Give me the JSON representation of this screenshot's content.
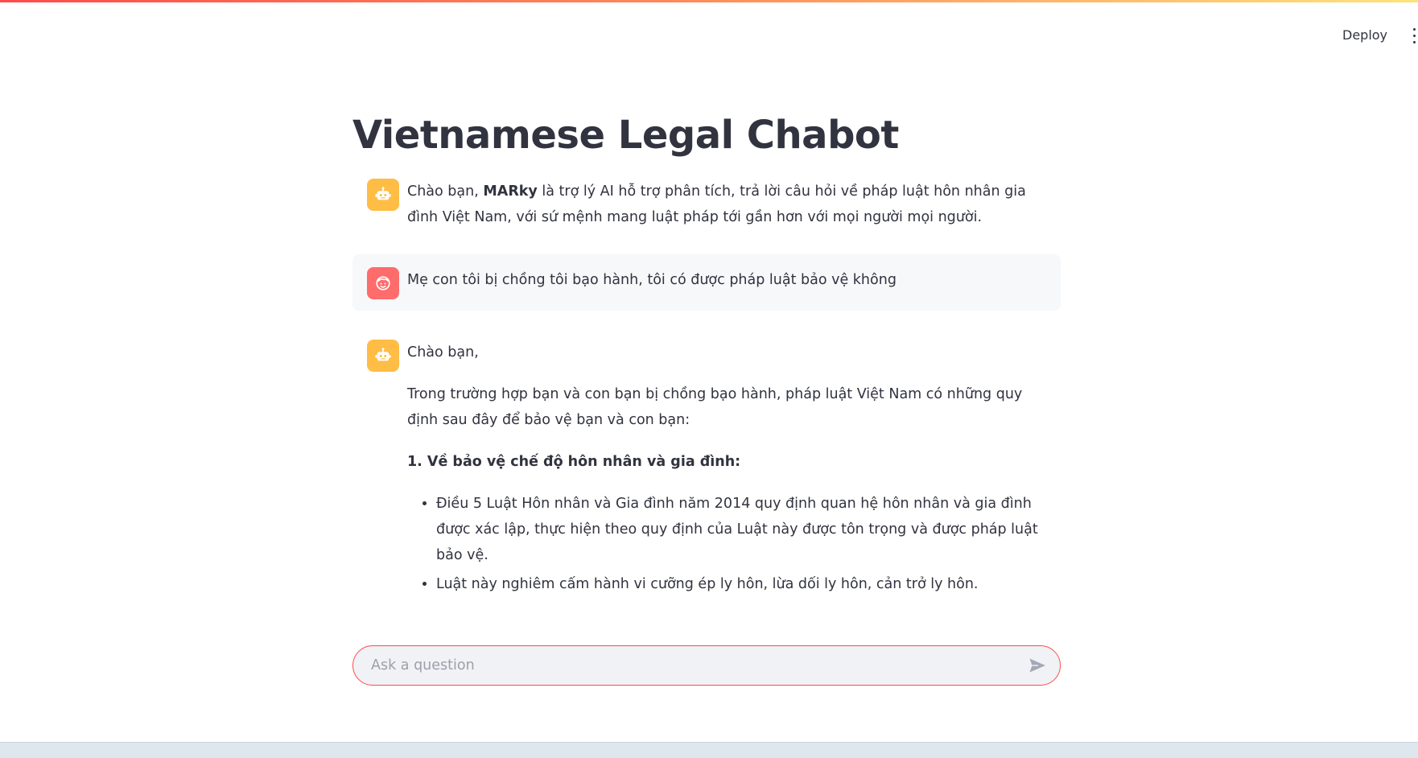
{
  "header": {
    "deploy_label": "Deploy"
  },
  "title": "Vietnamese Legal Chabot",
  "messages": {
    "m0": {
      "role": "assistant",
      "greet": "Chào bạn, ",
      "name": "MARky",
      "rest": " là trợ lý AI hỗ trợ phân tích, trả lời câu hỏi về pháp luật hôn nhân gia đình Việt Nam, với sứ mệnh mang luật pháp tới gần hơn với mọi người mọi người."
    },
    "m1": {
      "role": "user",
      "text": "Mẹ con tôi bị chồng tôi bạo hành, tôi có được pháp luật bảo vệ không"
    },
    "m2": {
      "role": "assistant",
      "greeting": "Chào bạn,",
      "intro": "Trong trường hợp bạn và con bạn bị chồng bạo hành, pháp luật Việt Nam có những quy định sau đây để bảo vệ bạn và con bạn:",
      "heading": "1. Về bảo vệ chế độ hôn nhân và gia đình:",
      "bullets": [
        "Điều 5 Luật Hôn nhân và Gia đình năm 2014 quy định quan hệ hôn nhân và gia đình được xác lập, thực hiện theo quy định của Luật này được tôn trọng và được pháp luật bảo vệ.",
        "Luật này nghiêm cấm hành vi cưỡng ép ly hôn, lừa dối ly hôn, cản trở ly hôn."
      ]
    }
  },
  "chat_input": {
    "placeholder": "Ask a question",
    "value": ""
  },
  "icons": {
    "bot": "robot-icon",
    "user": "face-icon",
    "send": "send-icon",
    "menu": "kebab-menu-icon"
  },
  "colors": {
    "accent": "#ff4b4b",
    "bot_avatar": "#ffbd45",
    "user_avatar": "#ff6c6c",
    "text": "#31333f"
  }
}
